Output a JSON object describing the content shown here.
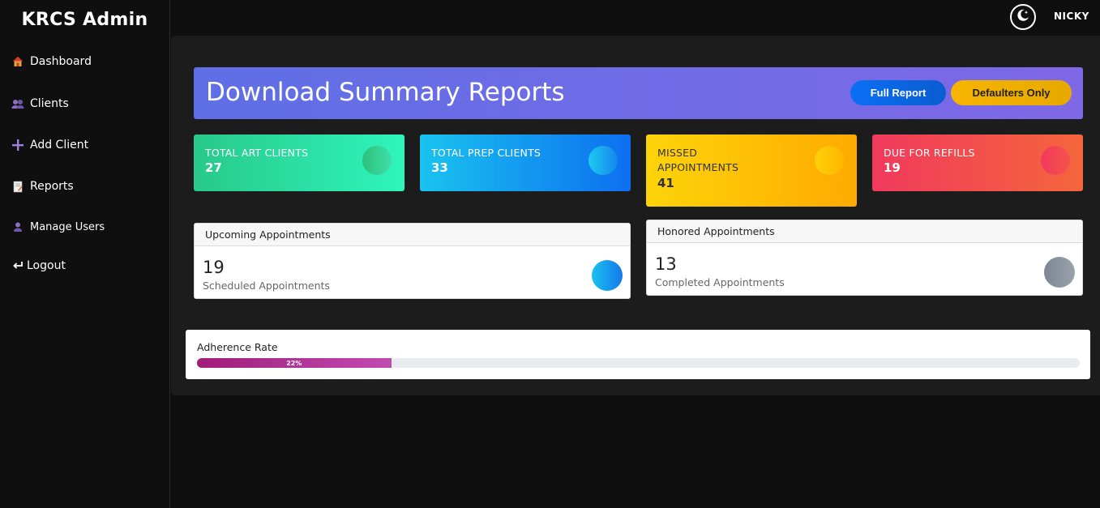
{
  "sidebar": {
    "brand": "KRCS Admin",
    "items": [
      {
        "label": "Dashboard",
        "icon": "house-icon"
      },
      {
        "label": "Clients",
        "icon": "users-icon"
      },
      {
        "label": "Add Client",
        "icon": "plus-icon"
      },
      {
        "label": "Reports",
        "icon": "report-icon"
      },
      {
        "label": "Manage Users",
        "icon": "user-icon"
      },
      {
        "label": "Logout",
        "icon": "logout-icon"
      }
    ]
  },
  "topbar": {
    "theme_toggle_icon": "moon-icon",
    "username": "NICKY"
  },
  "banner": {
    "title": "Download Summary Reports",
    "full_report_label": "Full Report",
    "defaulters_label": "Defaulters Only"
  },
  "stats": [
    {
      "label": "TOTAL ART CLIENTS",
      "value": "27",
      "color_from": "#28c98a",
      "color_to": "#2ef5bb"
    },
    {
      "label": "TOTAL PREP CLIENTS",
      "value": "33",
      "color_from": "#19c3ef",
      "color_to": "#0d6ff0"
    },
    {
      "label": "MISSED APPOINTMENTS",
      "value": "41",
      "color_from": "#fdd40a",
      "color_to": "#ffaa00"
    },
    {
      "label": "DUE FOR REFILLS",
      "value": "19",
      "color_from": "#f1395d",
      "color_to": "#f4663c"
    }
  ],
  "upcoming": {
    "header": "Upcoming Appointments",
    "value": "19",
    "subtitle": "Scheduled Appointments"
  },
  "honored": {
    "header": "Honored Appointments",
    "value": "13",
    "subtitle": "Completed Appointments"
  },
  "adherence": {
    "label": "Adherence Rate",
    "percent_text": "22%",
    "percent": 22
  }
}
